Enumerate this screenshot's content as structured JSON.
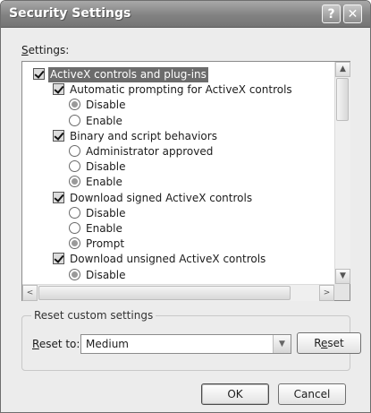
{
  "window": {
    "title": "Security Settings"
  },
  "titlebar": {
    "help_glyph": "?",
    "close_glyph": "✕"
  },
  "settings": {
    "label_prefix": "",
    "label_accel": "S",
    "label_rest": "ettings:",
    "items": [
      {
        "kind": "checkbox",
        "label": "ActiveX controls and plug-ins",
        "selected": true,
        "level": 0
      },
      {
        "kind": "checkbox",
        "label": "Automatic prompting for ActiveX controls",
        "level": 1
      },
      {
        "kind": "radio",
        "label": "Disable",
        "checked": true,
        "level": 2
      },
      {
        "kind": "radio",
        "label": "Enable",
        "checked": false,
        "level": 2
      },
      {
        "kind": "checkbox",
        "label": "Binary and script behaviors",
        "level": 1
      },
      {
        "kind": "radio",
        "label": "Administrator approved",
        "checked": false,
        "level": 2
      },
      {
        "kind": "radio",
        "label": "Disable",
        "checked": false,
        "level": 2
      },
      {
        "kind": "radio",
        "label": "Enable",
        "checked": true,
        "level": 2
      },
      {
        "kind": "checkbox",
        "label": "Download signed ActiveX controls",
        "level": 1
      },
      {
        "kind": "radio",
        "label": "Disable",
        "checked": false,
        "level": 2
      },
      {
        "kind": "radio",
        "label": "Enable",
        "checked": false,
        "level": 2
      },
      {
        "kind": "radio",
        "label": "Prompt",
        "checked": true,
        "level": 2
      },
      {
        "kind": "checkbox",
        "label": "Download unsigned ActiveX controls",
        "level": 1
      },
      {
        "kind": "radio",
        "label": "Disable",
        "checked": true,
        "level": 2
      }
    ]
  },
  "scrollbars": {
    "up": "▲",
    "down": "▼",
    "left": "<",
    "right": ">"
  },
  "reset": {
    "group_title": "Reset custom settings",
    "label_accel": "R",
    "label_rest": "eset to:",
    "selected_value": "Medium",
    "dropdown_arrow": "▼",
    "button_prefix": "R",
    "button_accel": "e",
    "button_rest": "set"
  },
  "footer": {
    "ok_label": "OK",
    "cancel_label": "Cancel"
  }
}
